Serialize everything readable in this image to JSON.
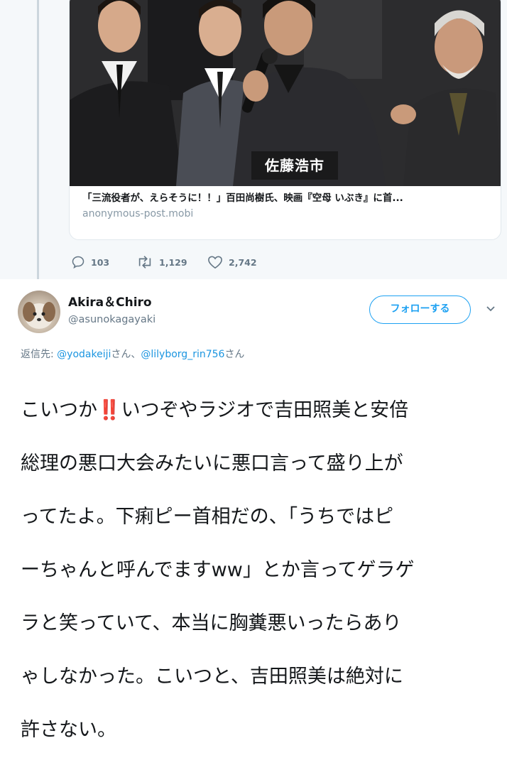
{
  "quoted": {
    "card": {
      "overlay_caption": "佐藤浩市",
      "title": "「三流役者が、えらそうに！！」百田尚樹氏、映画『空母 いぶき』に首...",
      "domain": "anonymous-post.mobi"
    },
    "actions": {
      "reply_count": "103",
      "retweet_count": "1,129",
      "like_count": "2,742"
    }
  },
  "tweet": {
    "display_name": "Akira＆Chiro",
    "handle": "@asunokagayaki",
    "follow_label": "フォローする",
    "reply_prefix": "返信先: ",
    "reply_mention_1": "@yodakeiji",
    "reply_sep": "さん、",
    "reply_mention_2": "@lilyborg_rin756",
    "reply_suffix": "さん",
    "text_lines": {
      "l1a": "こいつか",
      "l1_emoji": "‼️",
      "l1b": "いつぞやラジオで吉田照美と安倍",
      "l2": "総理の悪口大会みたいに悪口言って盛り上が",
      "l3": "ってたよ。下痢ピー首相だの、「うちではピ",
      "l4": "ーちゃんと呼んでますww」とか言ってゲラゲ",
      "l5": "ラと笑っていて、本当に胸糞悪いったらあり",
      "l6": "ゃしなかった。こいつと、吉田照美は絶対に",
      "l7": "許さない。"
    }
  },
  "colors": {
    "accent": "#1da1f2",
    "text": "#14171a",
    "secondary": "#657786",
    "emoji_red": "#e0245e"
  }
}
